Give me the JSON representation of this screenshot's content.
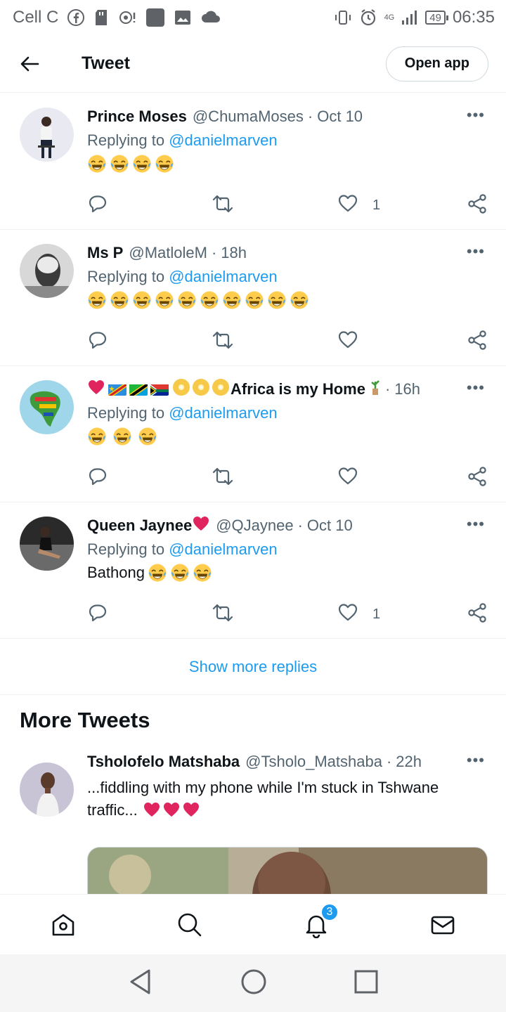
{
  "status_bar": {
    "carrier": "Cell C",
    "network_tag": "4G",
    "battery": "49",
    "time": "06:35"
  },
  "header": {
    "title": "Tweet",
    "open_app_label": "Open app"
  },
  "replies": [
    {
      "name": "Prince Moses",
      "handle": "@ChumaMoses",
      "time": "Oct 10",
      "replying_prefix": "Replying to",
      "replying_to": "@danielmarven",
      "text": "",
      "emoji_count": 4,
      "likes": "1"
    },
    {
      "name": "Ms P",
      "handle": "@MatloleM",
      "time": "18h",
      "replying_prefix": "Replying to",
      "replying_to": "@danielmarven",
      "text": "",
      "emoji_count": 10,
      "likes": ""
    },
    {
      "name": "Africa is my Home",
      "handle": "",
      "time": "16h",
      "replying_prefix": "Replying to",
      "replying_to": "@danielmarven",
      "text": "",
      "emoji_count": 3,
      "likes": ""
    },
    {
      "name": "Queen Jaynee",
      "handle": "@QJaynee",
      "time": "Oct 10",
      "replying_prefix": "Replying to",
      "replying_to": "@danielmarven",
      "text": "Bathong",
      "emoji_count": 3,
      "likes": "1"
    }
  ],
  "show_more_label": "Show more replies",
  "more_tweets": {
    "heading": "More Tweets",
    "tweet": {
      "name": "Tsholofelo Matshaba",
      "handle": "@Tsholo_Matshaba",
      "time": "22h",
      "text": "...fiddling with my phone while I'm stuck in Tshwane traffic..."
    }
  },
  "bottom_nav": {
    "notification_badge": "3"
  },
  "colors": {
    "accent": "#1d9bf0",
    "text_primary": "#0f1419",
    "text_secondary": "#536471",
    "heart": "#e0245e"
  }
}
